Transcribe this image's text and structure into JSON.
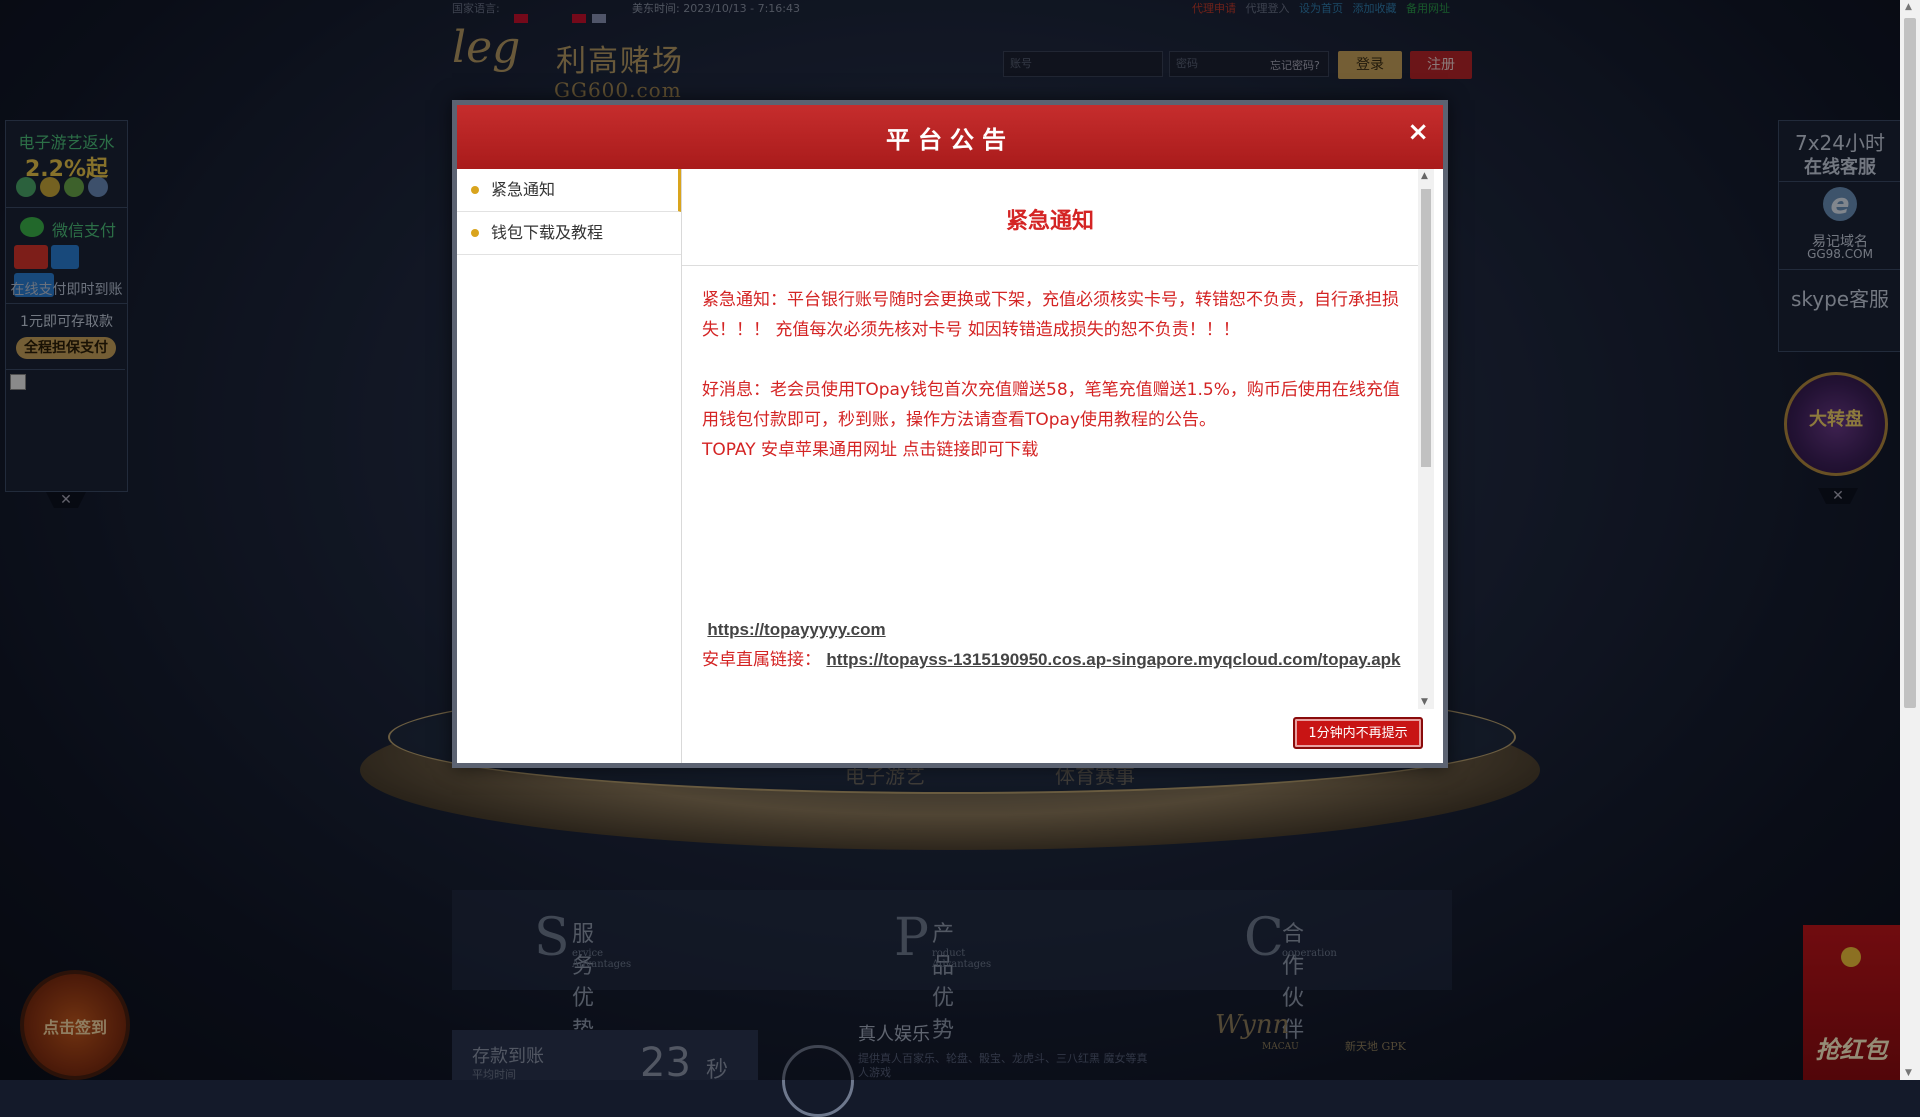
{
  "topbar": {
    "lang_label": "国家语言:",
    "time": "美东时间: 2023/10/13 - 7:16:43",
    "links": [
      "代理申请",
      "代理登入",
      "设为首页",
      "添加收藏",
      "备用网址"
    ]
  },
  "logo": {
    "script": "leg",
    "name": "利高赌场",
    "domain": "GG600.com"
  },
  "login": {
    "account_placeholder": "账号",
    "password_placeholder": "密码",
    "forgot": "忘记密码?",
    "login_label": "登录",
    "register_label": "注册"
  },
  "left_ad": {
    "rebate_title": "电子游艺返水",
    "rebate_value": "2.2%起",
    "wechat_pay": "微信支付",
    "online_pay": "在线支付即时到账",
    "deposit_min": "1元即可存取款",
    "guarantee": "全程担保支付",
    "close": "✕"
  },
  "right_ad": {
    "service_hours": "7x24小时",
    "online_service": "在线客服",
    "easy_domain": "易记域名",
    "domain": "GG98.COM",
    "skype": "skype客服",
    "close": "✕"
  },
  "promo_badge": "大转盘",
  "signin_button": "点击签到",
  "red_packet": "抢红包",
  "advantages": [
    {
      "letter": "S",
      "title": "服务优势",
      "subtitle": "ervice Advantages"
    },
    {
      "letter": "P",
      "title": "产品优势",
      "subtitle": "roduct Advantages"
    },
    {
      "letter": "C",
      "title": "合作伙伴",
      "subtitle": "ooperation"
    }
  ],
  "deposit": {
    "label": "存款到账",
    "sub": "平均时间",
    "value": "23",
    "unit": "秒"
  },
  "live": {
    "title": "真人娱乐",
    "desc": "提供真人百家乐、轮盘、骰宝、龙虎斗、三八红黑 魔女等真人游戏"
  },
  "partners": {
    "wynn": "Wynn",
    "wynn_sub": "MACAU",
    "gpk": "新天地 GPK"
  },
  "stage_items": [
    "电子游艺",
    "体育赛事"
  ],
  "modal": {
    "title": "平台公告",
    "close": "×",
    "nav": [
      "紧急通知",
      "钱包下载及教程"
    ],
    "content_title": "紧急通知",
    "paragraph1": "紧急通知：平台银行账号随时会更换或下架，充值必须核实卡号，转错恕不负责，自行承担损失！！！ 充值每次必须先核对卡号 如因转错造成损失的恕不负责！！！",
    "paragraph2": "好消息：老会员使用TOpay钱包首次充值赠送58，笔笔充值赠送1.5%，购币后使用在线充值用钱包付款即可，秒到账，操作方法请查看TOpay使用教程的公告。",
    "paragraph3": "TOPAY 安卓苹果通用网址  点击链接即可下载",
    "link1": "https://topayyyyy.com",
    "android_label": "安卓直属链接：",
    "link2": "https://topayss-1315190950.cos.ap-singapore.myqcloud.com/topay.apk",
    "dismiss_label": "1分钟内不再提示"
  },
  "colors": {
    "modal_header": "#c62d2d",
    "notice_red": "#d42424",
    "accent_gold": "#d9a41d"
  }
}
